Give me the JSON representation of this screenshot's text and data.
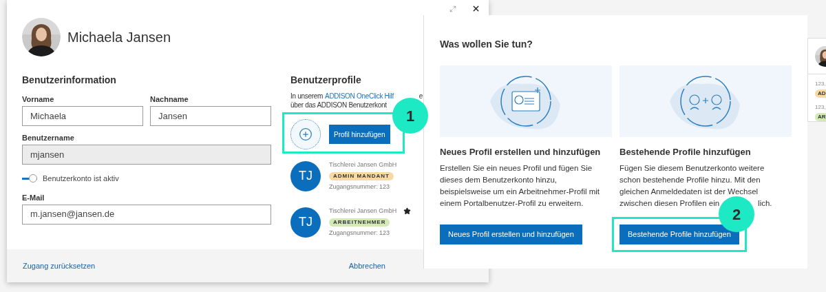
{
  "user_dialog": {
    "name": "Michaela Jansen",
    "info_title": "Benutzerinformation",
    "fields": [
      {
        "kind": "pair",
        "items": [
          {
            "label": "Vorname",
            "value": "Michaela"
          },
          {
            "label": "Nachname",
            "value": "Jansen"
          }
        ]
      },
      {
        "kind": "text",
        "label": "Benutzername",
        "value": "mjansen",
        "disabled": true
      },
      {
        "kind": "toggle",
        "label": "Benutzerkonto ist aktiv",
        "on": true
      },
      {
        "kind": "text",
        "label": "E-Mail",
        "value": "m.jansen@jansen.de",
        "disabled": false
      }
    ],
    "profiles_title": "Benutzerprofile",
    "intro_before": "In unserem ",
    "intro_link": "ADDISON OneClick Hilf",
    "intro_after": "e",
    "intro_line2": "über das ADDISON Benutzerkont",
    "add_button": "Profil hinzufügen",
    "profiles": [
      {
        "initials": "TJ",
        "company": "Tischlerei Jansen GmbH",
        "role": "ADMIN MANDANT",
        "color": "#f8d9a6",
        "number": "Zugangsnummer: 123",
        "favorite": false
      },
      {
        "initials": "TJ",
        "company": "Tischlerei Jansen GmbH",
        "role": "ARBEITNEHMER",
        "color": "#d3eab5",
        "number": "Zugangsnummer: 123",
        "favorite": true
      }
    ],
    "footer_left": "Zugang zurücksetzen",
    "footer_right": "Abbrechen"
  },
  "choice_panel": {
    "title": "Was wollen Sie tun?",
    "options": [
      {
        "kind": "card",
        "heading": "Neues Profil erstellen und hinzufügen",
        "lines": [
          [
            "Erstellen Sie ein neues Profil und fügen Sie"
          ],
          [
            "dieses dem Benutzerkonto hinzu,"
          ],
          [
            "beispielsweise um ein Arbeitnehmer-Profil mit"
          ],
          [
            "einem Portalbenutzer-Profil zu erweitern."
          ]
        ],
        "button": "Neues Profil erstellen und hinzufügen",
        "highlighted": false
      },
      {
        "kind": "pair",
        "heading": "Bestehende Profile hinzufügen",
        "lines": [
          [
            "Fügen Sie diesem Benutzerkonto weitere"
          ],
          [
            "schon bestehende Profile hinzu. Mit den"
          ],
          [
            "gleichen Anmeldedaten ist der Wechsel"
          ],
          [
            "zwischen diesen Profilen ein",
            "lich."
          ]
        ],
        "button": "Bestehende Profile hinzufügen",
        "highlighted": true
      }
    ]
  },
  "callouts": [
    {
      "label": "1"
    },
    {
      "label": "2"
    }
  ],
  "background_card": {
    "rows": [
      {
        "text": "123,",
        "badge": "AD",
        "color": "#f8d9a6"
      },
      {
        "text": "123,",
        "badge": "AR",
        "color": "#d3eab5"
      }
    ]
  }
}
